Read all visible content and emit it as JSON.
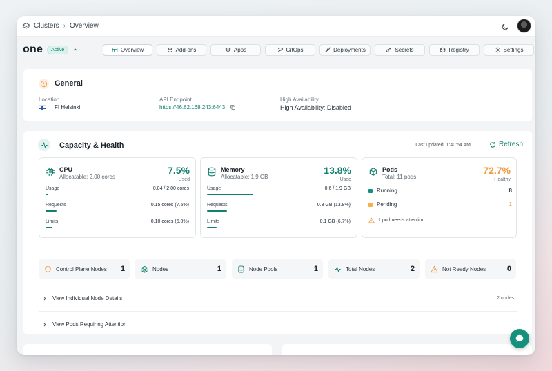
{
  "breadcrumb": {
    "root": "Clusters",
    "current": "Overview"
  },
  "cluster": {
    "name": "one",
    "status": "Active"
  },
  "tabs": [
    {
      "label": "Overview",
      "icon": "layout-icon",
      "active": true
    },
    {
      "label": "Add-ons",
      "icon": "box-icon",
      "active": false
    },
    {
      "label": "Apps",
      "icon": "layers-icon",
      "active": false
    },
    {
      "label": "GitOps",
      "icon": "git-icon",
      "active": false
    },
    {
      "label": "Deployments",
      "icon": "rocket-icon",
      "active": false
    },
    {
      "label": "Secrets",
      "icon": "key-icon",
      "active": false
    },
    {
      "label": "Registry",
      "icon": "package-icon",
      "active": false
    },
    {
      "label": "Settings",
      "icon": "gear-icon",
      "active": false
    }
  ],
  "general": {
    "title": "General",
    "location_label": "Location",
    "location_value": "FI Helsinki",
    "api_label": "API Endpoint",
    "api_value": "https://46.62.168.243:6443",
    "ha_label": "High Availability",
    "ha_value": "High Availability: Disabled"
  },
  "health": {
    "title": "Capacity & Health",
    "last_updated": "Last updated: 1:40:54 AM",
    "refresh_label": "Refresh",
    "cpu": {
      "title": "CPU",
      "subtitle": "Allocatable: 2.00 cores",
      "percent": "7.5%",
      "percent_label": "Used",
      "usage_label": "Usage",
      "usage_value": "0.04 / 2.00 cores",
      "usage_fill": 0.02,
      "requests_label": "Requests",
      "requests_value": "0.15 cores (7.5%)",
      "requests_fill": 0.075,
      "limits_label": "Limits",
      "limits_value": "0.10 cores (5.0%)",
      "limits_fill": 0.05
    },
    "memory": {
      "title": "Memory",
      "subtitle": "Allocatable: 1.9 GB",
      "percent": "13.8%",
      "percent_label": "Used",
      "usage_label": "Usage",
      "usage_value": "0.6 / 1.9 GB",
      "usage_fill": 0.32,
      "requests_label": "Requests",
      "requests_value": "0.3 GB (13.8%)",
      "requests_fill": 0.138,
      "limits_label": "Limits",
      "limits_value": "0.1 GB (6.7%)",
      "limits_fill": 0.067
    },
    "pods": {
      "title": "Pods",
      "subtitle": "Total: 11 pods",
      "percent": "72.7%",
      "percent_label": "Healthy",
      "running_label": "Running",
      "running_value": "8",
      "pending_label": "Pending",
      "pending_value": "1",
      "attention": "1 pod needs attention"
    },
    "stats": [
      {
        "label": "Control Plane Nodes",
        "value": "1",
        "icon": "shield-icon"
      },
      {
        "label": "Nodes",
        "value": "1",
        "icon": "layers-icon"
      },
      {
        "label": "Node Pools",
        "value": "1",
        "icon": "database-icon"
      },
      {
        "label": "Total Nodes",
        "value": "2",
        "icon": "activity-icon"
      },
      {
        "label": "Not Ready Nodes",
        "value": "0",
        "icon": "warning-icon"
      }
    ],
    "node_details_label": "View Individual Node Details",
    "node_details_count": "2 nodes",
    "pods_attention_label": "View Pods Requiring Attention"
  },
  "colors": {
    "accent": "#12806f",
    "warning": "#f19a3e",
    "running": "#14907d",
    "pending": "#f5b04a"
  }
}
